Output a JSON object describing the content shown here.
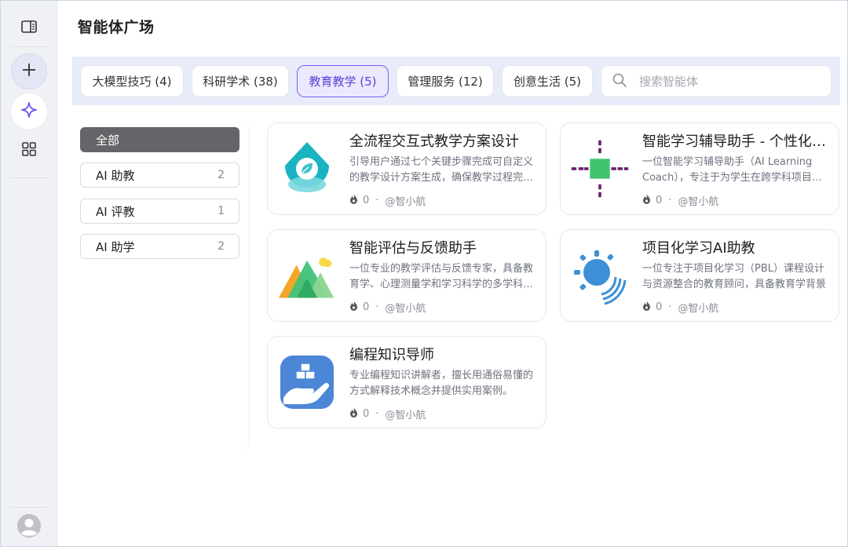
{
  "page": {
    "title": "智能体广场"
  },
  "rail": {
    "icons": [
      "sidebar-toggle-icon",
      "plus-icon",
      "sparkle-icon",
      "grid-icon",
      "user-avatar-icon"
    ]
  },
  "categories": [
    {
      "label": "大模型技巧 (4)",
      "active": false
    },
    {
      "label": "科研学术 (38)",
      "active": false
    },
    {
      "label": "教育教学 (5)",
      "active": true
    },
    {
      "label": "管理服务 (12)",
      "active": false
    },
    {
      "label": "创意生活 (5)",
      "active": false
    }
  ],
  "search": {
    "placeholder": "搜索智能体",
    "value": ""
  },
  "subcategories": [
    {
      "label": "全部",
      "count": "",
      "active": true
    },
    {
      "label": "AI 助教",
      "count": "2",
      "active": false
    },
    {
      "label": "AI 评教",
      "count": "1",
      "active": false
    },
    {
      "label": "AI 助学",
      "count": "2",
      "active": false
    }
  ],
  "agents": [
    {
      "name": "全流程交互式教学方案设计",
      "description": "引导用户通过七个关键步骤完成可自定义的教学设计方案生成，确保教学过程完整清晰",
      "likes": "0",
      "author": "@智小航",
      "icon": "water-drop-leaf-icon"
    },
    {
      "name": "智能学习辅导助手 - 个性化学习伙伴",
      "description": "一位智能学习辅导助手（AI Learning Coach），专注于为学生在跨学科项目中提供帮助",
      "likes": "0",
      "author": "@智小航",
      "icon": "connector-square-icon"
    },
    {
      "name": "智能评估与反馈助手",
      "description": "一位专业的教学评估与反馈专家，具备教育学、心理测量学和学习科学的多学科背景",
      "likes": "0",
      "author": "@智小航",
      "icon": "mountains-cloud-icon"
    },
    {
      "name": "项目化学习AI助教",
      "description": "一位专注于项目化学习（PBL）课程设计与资源整合的教育顾问，具备教育学背景",
      "likes": "0",
      "author": "@智小航",
      "icon": "sun-waves-icon"
    },
    {
      "name": "编程知识导师",
      "description": "专业编程知识讲解者，擅长用通俗易懂的方式解释技术概念并提供实用案例。",
      "likes": "0",
      "author": "@智小航",
      "icon": "hand-blocks-icon"
    }
  ],
  "colors": {
    "accent": "#6f4ff2",
    "active_chip_bg": "#ece9ff",
    "category_bar_bg": "#e8ecfa",
    "subcategory_active_bg": "#656569"
  }
}
